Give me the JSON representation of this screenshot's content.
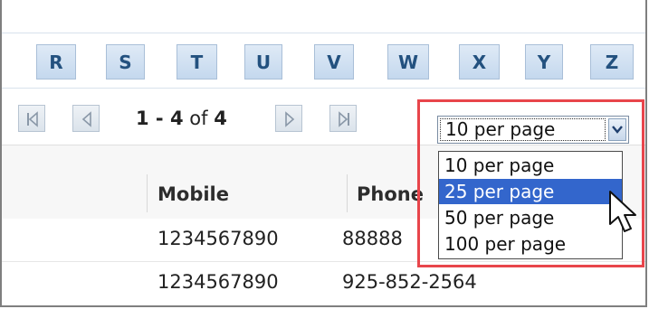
{
  "alphabet": {
    "letters": [
      "R",
      "S",
      "T",
      "U",
      "V",
      "W",
      "X",
      "Y",
      "Z"
    ]
  },
  "pager": {
    "range_start": "1",
    "range_sep": " - ",
    "range_end": "4",
    "of_label": " of ",
    "total": "4",
    "icons": {
      "first": "first-page-icon",
      "prev": "previous-page-icon",
      "next": "next-page-icon",
      "last": "last-page-icon"
    }
  },
  "page_size": {
    "selected_value": "10 per page",
    "options": [
      "10 per page",
      "25 per page",
      "50 per page",
      "100 per page"
    ],
    "highlighted_option": "25 per page"
  },
  "table": {
    "columns": [
      "Mobile",
      "Phone"
    ],
    "rows": [
      {
        "mobile": "1234567890",
        "phone": "88888"
      },
      {
        "mobile": "1234567890",
        "phone": "925-852-2564"
      }
    ]
  },
  "colors": {
    "letter_text": "#23517f",
    "highlight_border": "#e8454b",
    "selected_option_bg": "#3366cc"
  }
}
